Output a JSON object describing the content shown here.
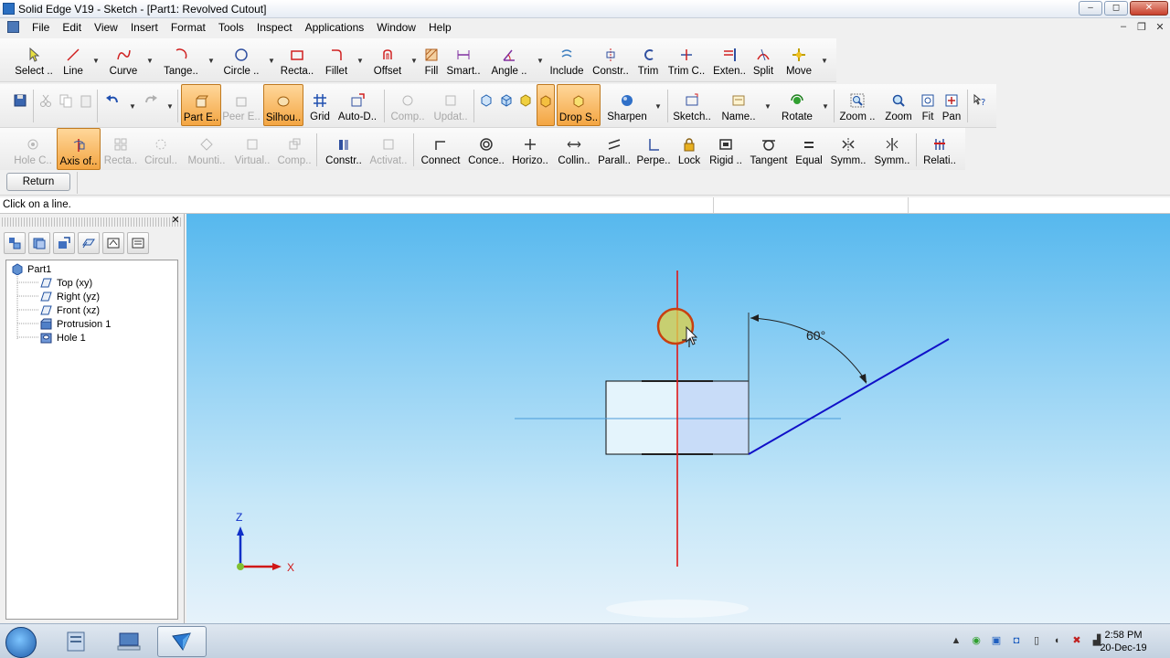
{
  "window": {
    "title": "Solid Edge V19 - Sketch - [Part1: Revolved Cutout]",
    "minimize": "–",
    "maximize": "◻",
    "close": "✕"
  },
  "menu": {
    "items": [
      "File",
      "Edit",
      "View",
      "Insert",
      "Format",
      "Tools",
      "Inspect",
      "Applications",
      "Window",
      "Help"
    ],
    "mdi_minimize": "–",
    "mdi_restore": "❐",
    "mdi_close": "✕"
  },
  "draw_toolbar": [
    "Select ..",
    "Line",
    "Curve",
    "Tange..",
    "Circle ..",
    "Recta..",
    "Fillet",
    "Offset",
    "Fill",
    "Smart..",
    "Angle ..",
    "Include",
    "Constr..",
    "Trim",
    "Trim C..",
    "Exten..",
    "Split",
    "Move"
  ],
  "view_toolbar": [
    "Part E..",
    "Peer E..",
    "Silhou..",
    "Grid",
    "Auto-D..",
    "Comp..",
    "Updat..",
    "Drop S..",
    "Sharpen",
    "Sketch..",
    "Name..",
    "Rotate",
    "Zoom ..",
    "Zoom",
    "Fit",
    "Pan"
  ],
  "relate_toolbar": [
    "Hole C..",
    "Axis of..",
    "Recta..",
    "Circul..",
    "Mounti..",
    "Virtual..",
    "Comp..",
    "Constr..",
    "Activat..",
    "Connect",
    "Conce..",
    "Horizo..",
    "Collin..",
    "Parall..",
    "Perpe..",
    "Lock",
    "Rigid ..",
    "Tangent",
    "Equal",
    "Symm..",
    "Symm..",
    "Relati.."
  ],
  "return_button": "Return",
  "prompt": "Click on a line.",
  "pathfinder": {
    "close": "✕",
    "tree": [
      "Part1",
      "Top (xy)",
      "Right (yz)",
      "Front (xz)",
      "Protrusion 1",
      "Hole 1"
    ]
  },
  "sketch": {
    "angle_label": "60°",
    "axis_z": "Z",
    "axis_x": "X",
    "colors": {
      "axis_line": "#e01818",
      "profile_line": "#1010c8",
      "highlight": "#e8c020"
    }
  },
  "taskbar": {
    "time": "2:58 PM",
    "date": "20-Dec-19"
  }
}
